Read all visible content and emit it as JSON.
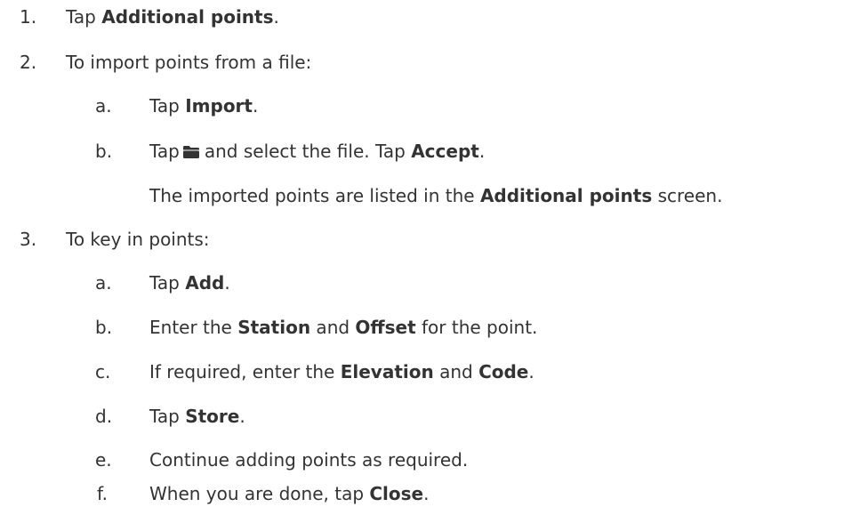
{
  "steps": [
    {
      "number": "1.",
      "text_pre": "Tap ",
      "bold": "Additional points",
      "text_post": "."
    },
    {
      "number": "2.",
      "text": "To import points from a file:",
      "substeps": [
        {
          "letter": "a.",
          "text_pre": " Tap ",
          "bold": "Import",
          "text_post": "."
        },
        {
          "letter": "b.",
          "text_pre": "Tap",
          "icon": "folder-icon",
          "text_mid": "and select the file. Tap ",
          "bold": "Accept",
          "text_post": ".",
          "note_pre": "The imported points are listed in the ",
          "note_bold": "Additional points",
          "note_post": " screen."
        }
      ]
    },
    {
      "number": "3.",
      "text": "To key in points:",
      "substeps": [
        {
          "letter": "a.",
          "text_pre": "Tap ",
          "bold": "Add",
          "text_post": "."
        },
        {
          "letter": "b.",
          "text_pre": "Enter the ",
          "bold1": "Station",
          "text_mid": " and ",
          "bold2": "Offset",
          "text_post": " for the point."
        },
        {
          "letter": "c.",
          "text_pre": "If required, enter the ",
          "bold1": "Elevation",
          "text_mid": " and ",
          "bold2": "Code",
          "text_post": "."
        },
        {
          "letter": "d.",
          "text_pre": "Tap ",
          "bold": "Store",
          "text_post": "."
        },
        {
          "letter": "e.",
          "text": "Continue adding points as required."
        },
        {
          "letter": "f.",
          "text_pre": " When you are done, tap ",
          "bold": "Close",
          "text_post": "."
        }
      ]
    }
  ]
}
